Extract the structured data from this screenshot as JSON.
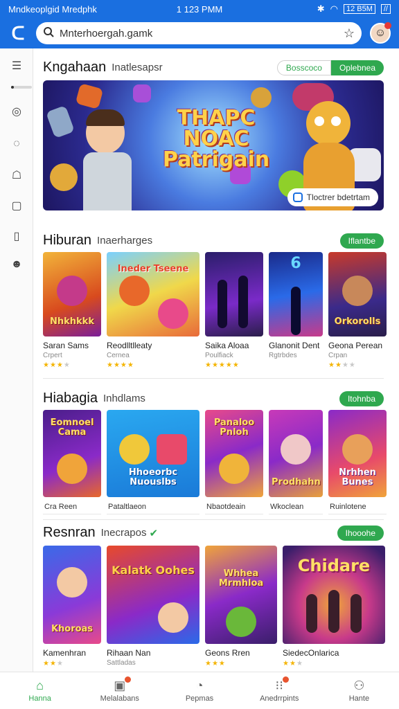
{
  "status": {
    "left": "Mndkeoplgid Mredphk",
    "time": "1 123 PMM",
    "battery": "12 B5M"
  },
  "search": {
    "value": "Mnterhoergah.gamk"
  },
  "sidebar": {
    "items": [
      "menu",
      "disc",
      "a",
      "game",
      "square",
      "info",
      "face"
    ]
  },
  "featured": {
    "title": "Kngahaan",
    "subtitle": "Inatlesapsr",
    "btn_outline": "Bosscoco",
    "btn_green": "Oplebnea",
    "banner_title": "THAPC NOAC Patrigain",
    "banner_button": "Tloctrer bdetrtam"
  },
  "sections": [
    {
      "title": "Hiburan",
      "subtitle": "Inaerharges",
      "button": "Iflantbe",
      "cards": [
        {
          "name": "Saran Sams",
          "sub": "Crpert",
          "stars": 3,
          "art": "Nhkhkkk"
        },
        {
          "name": "Reodlltlleaty",
          "sub": "Cernea",
          "stars": 4,
          "art": "Ineder Tseene"
        },
        {
          "name": "Saika Aloaa",
          "sub": "Poulfiack",
          "stars": 5,
          "art": ""
        },
        {
          "name": "Glanonit Dent",
          "sub": "Rgtrbdes",
          "stars": 0,
          "art": "6"
        },
        {
          "name": "Geona Perean",
          "sub": "Crpan",
          "stars": 3,
          "art": "Orkorolls"
        }
      ]
    },
    {
      "title": "Hiabagia",
      "subtitle": "Inhdlams",
      "button": "Itohnba",
      "cards": [
        {
          "name": "Cra Reen",
          "art": "Eomnoel Cama"
        },
        {
          "name": "Pataltlaeon",
          "art": "Hhoeorbc Nuouslbs"
        },
        {
          "name": "Nbaotdeain",
          "art": "Panaloo Pnloh"
        },
        {
          "name": "Wkoclean",
          "art": "Prodhahn"
        },
        {
          "name": "Ruinlotene",
          "art": "Nrhhen Bunes"
        }
      ]
    },
    {
      "title": "Resnran",
      "subtitle": "Inecrapos",
      "button": "Ihooohe",
      "cards": [
        {
          "name": "Kamenhran",
          "sub": "",
          "stars": 2,
          "art": "Khoroas"
        },
        {
          "name": "Rihaan Nan",
          "sub": "Sattladas",
          "stars": 0,
          "art": "Kalatk Oohes"
        },
        {
          "name": "Geons Rren",
          "sub": "",
          "stars": 3,
          "art": "Whhea Mrmhloa"
        },
        {
          "name": "SiedecOnlarica",
          "sub": "",
          "stars": 3,
          "art": "Chidare"
        }
      ]
    }
  ],
  "nav": [
    {
      "label": "Hanna",
      "icon": "home-icon",
      "active": true
    },
    {
      "label": "Melalabans",
      "icon": "gift-icon",
      "badge": true
    },
    {
      "label": "Pepmas",
      "icon": "chat-icon"
    },
    {
      "label": "Anedrrpints",
      "icon": "gamepad-icon",
      "badge": true
    },
    {
      "label": "Hante",
      "icon": "profile-icon"
    }
  ]
}
